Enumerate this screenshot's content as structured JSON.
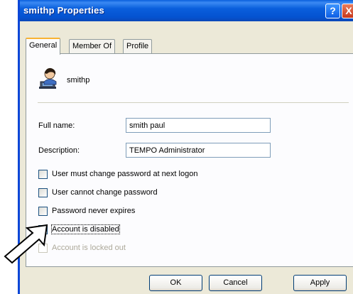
{
  "window": {
    "title": "smithp Properties",
    "help_glyph": "?",
    "close_glyph": "X"
  },
  "tabs": [
    {
      "label": "General",
      "active": true
    },
    {
      "label": "Member Of",
      "active": false
    },
    {
      "label": "Profile",
      "active": false
    }
  ],
  "user": {
    "icon": "user-icon",
    "name": "smithp"
  },
  "fields": {
    "full_name_label": "Full name:",
    "full_name_value": "smith paul",
    "description_label": "Description:",
    "description_value": "TEMPO Administrator"
  },
  "checkboxes": [
    {
      "label": "User must change password at next logon",
      "checked": false,
      "enabled": true
    },
    {
      "label": "User cannot change password",
      "checked": false,
      "enabled": true
    },
    {
      "label": "Password never expires",
      "checked": false,
      "enabled": true
    },
    {
      "label": "Account is disabled",
      "checked": false,
      "enabled": true,
      "focused": true
    },
    {
      "label": "Account is locked out",
      "checked": false,
      "enabled": false
    }
  ],
  "buttons": {
    "ok": "OK",
    "cancel": "Cancel",
    "apply": "Apply"
  },
  "annotation": {
    "icon": "pointer-arrow-icon",
    "target": "Account is disabled"
  },
  "colors": {
    "titlebar": "#0a5fdc",
    "face": "#ece9d8",
    "active_tab_accent": "#f8b332"
  }
}
